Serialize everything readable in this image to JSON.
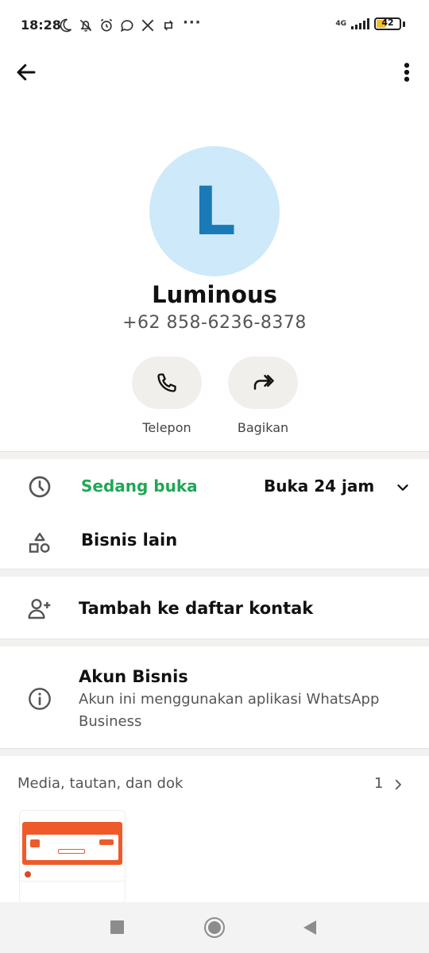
{
  "status_bar": {
    "time": "18:28",
    "more": "···",
    "network": "4G",
    "battery": "42",
    "battery_level_percent": 42
  },
  "contact": {
    "avatar_letter": "L",
    "name": "Luminous",
    "phone": "+62 858-6236-8378"
  },
  "actions": [
    {
      "label": "Telepon",
      "icon": "phone-icon"
    },
    {
      "label": "Bagikan",
      "icon": "share-icon"
    }
  ],
  "business_hours": {
    "status": "Sedang buka",
    "hours": "Buka 24 jam"
  },
  "other_business": {
    "label": "Bisnis lain"
  },
  "add_contact": {
    "label": "Tambah ke daftar kontak"
  },
  "business_account": {
    "title": "Akun Bisnis",
    "description": "Akun ini menggunakan aplikasi WhatsApp Business"
  },
  "media": {
    "header": "Media, tautan, dan dok",
    "count": "1"
  },
  "colors": {
    "accent_green": "#1fa855",
    "avatar_bg": "#cde9fa",
    "avatar_letter": "#1a7ab8"
  }
}
